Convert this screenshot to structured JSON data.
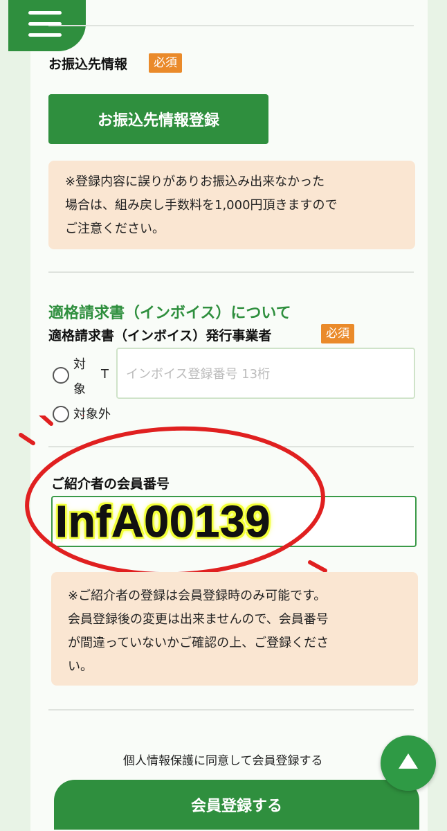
{
  "transfer": {
    "label": "お振込先情報",
    "required": "必須",
    "button": "お振込先情報登録",
    "notice_lines": [
      "※登録内容に誤りがありお振込み出来なかった",
      "場合は、組み戻し手数料を1,000円頂きますので",
      "ご注意ください。"
    ]
  },
  "invoice": {
    "section_title": "適格請求書（インボイス）について",
    "label": "適格請求書（インボイス）発行事業者",
    "required": "必須",
    "option_target_char1": "対",
    "option_target_char2": "象",
    "prefix": "T",
    "input_placeholder": "インボイス登録番号 13桁",
    "option_not_target": "対象外"
  },
  "referrer": {
    "label": "ご紹介者の会員番号",
    "overlay_code": "InfA00139",
    "notice_lines": [
      "※ご紹介者の登録は会員登録時のみ可能です。",
      "会員登録後の変更は出来ませんので、会員番号",
      "が間違っていないかご確認の上、ご登録くださ",
      "い。"
    ]
  },
  "footer": {
    "consent": "個人情報保護に同意して会員登録する",
    "submit": "会員登録する"
  },
  "icons": {
    "menu": "hamburger-menu-icon",
    "top": "back-to-top-icon"
  },
  "colors": {
    "brand_green": "#2f8f3e",
    "required_orange": "#ea8a2a",
    "notice_bg": "#fae6d2",
    "annotation_red": "#e02020",
    "highlight_yellow": "#f2ff3a"
  }
}
